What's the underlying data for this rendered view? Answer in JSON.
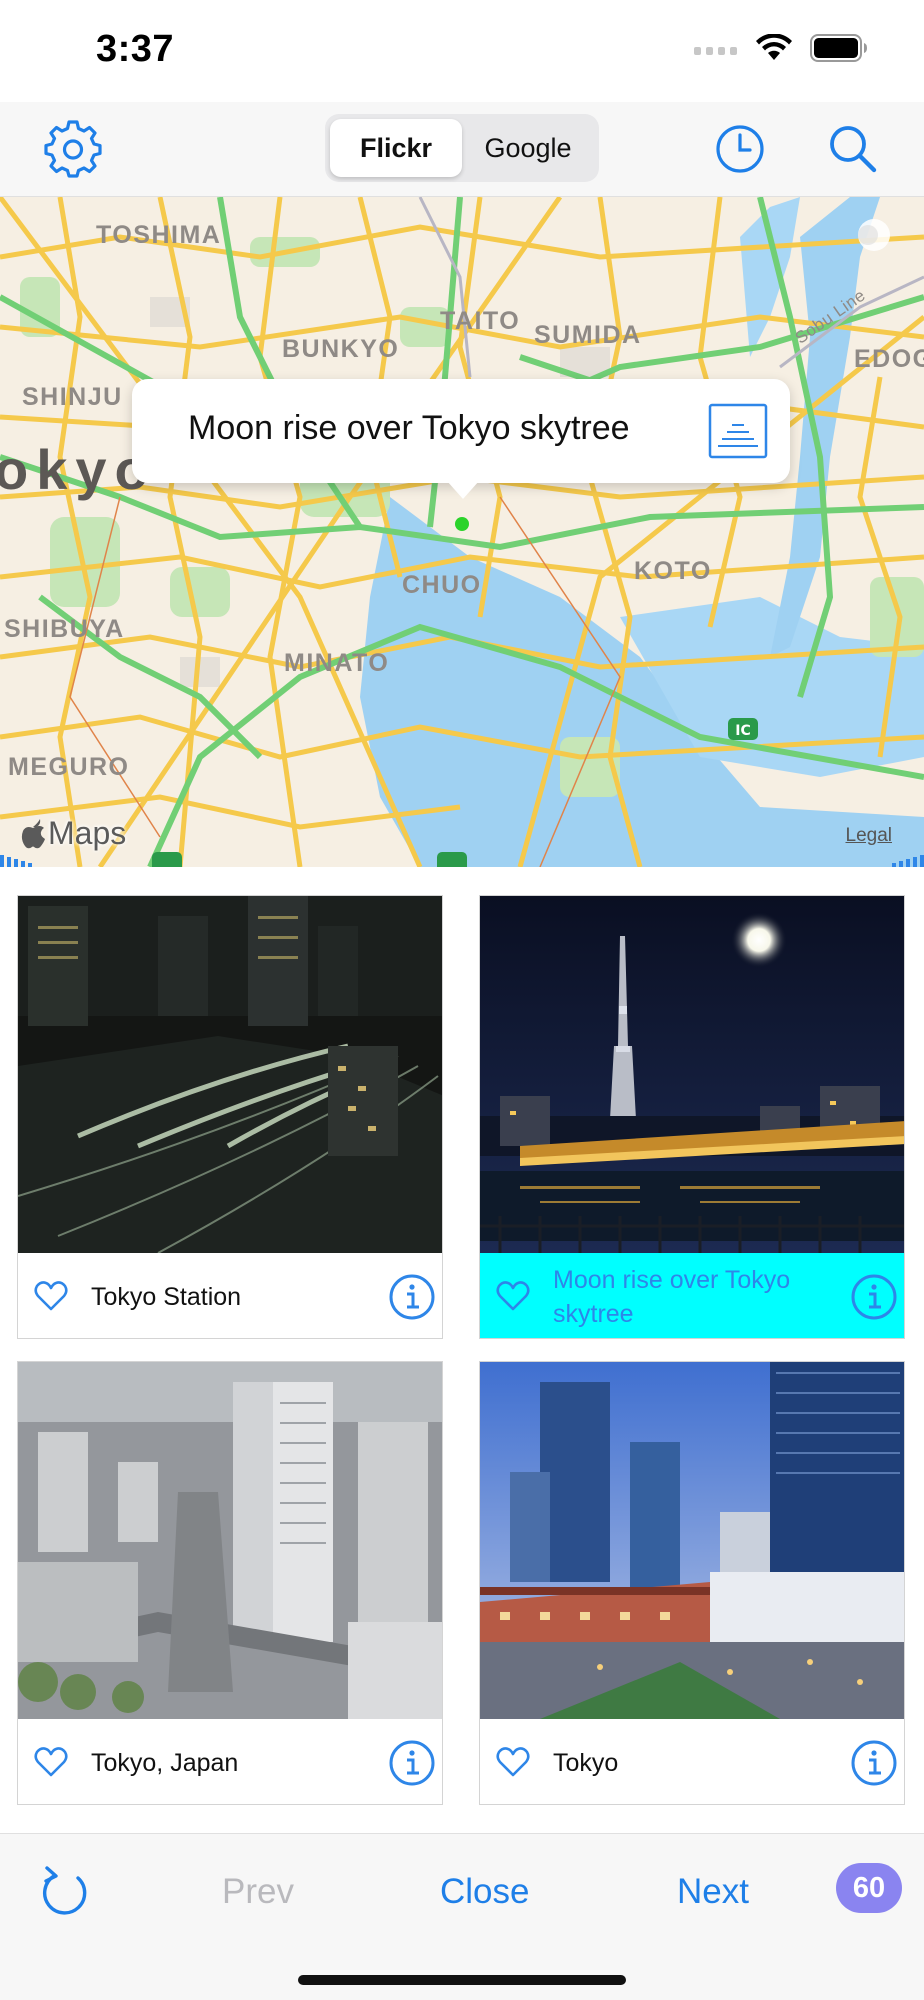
{
  "status_bar": {
    "time": "3:37"
  },
  "toolbar": {
    "segments": [
      {
        "label": "Flickr",
        "selected": true
      },
      {
        "label": "Google",
        "selected": false
      }
    ],
    "icons": [
      "gear-icon",
      "clock-icon",
      "search-icon"
    ],
    "accent_color": "#1e7fe8"
  },
  "map": {
    "labels": [
      "TOSHIMA",
      "TAITO",
      "SUMIDA",
      "BUNKYO",
      "SHINJU",
      "okyo",
      "KOTO",
      "CHUO",
      "SHIBUYA",
      "MINATO",
      "MEGURO",
      "EDOG",
      "Sobu Line"
    ],
    "callout_title": "Moon rise over Tokyo skytree",
    "logo_text": "Maps",
    "legal": "Legal",
    "road_signs": [
      "IC"
    ]
  },
  "photos": [
    {
      "caption": "Tokyo Station",
      "selected": false
    },
    {
      "caption": "Moon rise over Tokyo skytree",
      "selected": true
    },
    {
      "caption": "Tokyo, Japan",
      "selected": false
    },
    {
      "caption": "Tokyo",
      "selected": false
    }
  ],
  "bottom_bar": {
    "prev_label": "Prev",
    "close_label": "Close",
    "next_label": "Next",
    "count": "60"
  },
  "colors": {
    "selected_caption_bg": "#00ffff",
    "badge": "#8a84f0",
    "disabled": "#b9b9bd"
  }
}
